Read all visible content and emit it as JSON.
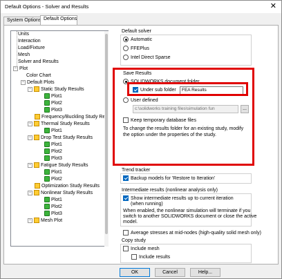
{
  "window": {
    "title": "Default Options - Solver and Results"
  },
  "tabs": [
    {
      "label": "System Options"
    },
    {
      "label": "Default Options"
    }
  ],
  "tree": {
    "items": [
      {
        "label": "Units"
      },
      {
        "label": "Interaction"
      },
      {
        "label": "Load/Fixture"
      },
      {
        "label": "Mesh"
      },
      {
        "label": "Solver and Results"
      },
      {
        "label": "Plot"
      },
      {
        "label": "Color Chart"
      },
      {
        "label": "Default Plots"
      },
      {
        "label": "Static Study Results"
      },
      {
        "label": "Plot1"
      },
      {
        "label": "Plot2"
      },
      {
        "label": "Plot3"
      },
      {
        "label": "Frequency/Buckling Study Res"
      },
      {
        "label": "Thermal Study Results"
      },
      {
        "label": "Plot1"
      },
      {
        "label": "Drop Test Study Results"
      },
      {
        "label": "Plot1"
      },
      {
        "label": "Plot2"
      },
      {
        "label": "Plot3"
      },
      {
        "label": "Fatigue Study Results"
      },
      {
        "label": "Plot1"
      },
      {
        "label": "Plot2"
      },
      {
        "label": "Optimization Study Results"
      },
      {
        "label": "Nonlinear Study Results"
      },
      {
        "label": "Plot1"
      },
      {
        "label": "Plot2"
      },
      {
        "label": "Plot3"
      },
      {
        "label": "Mesh Plot"
      }
    ]
  },
  "default_solver": {
    "heading": "Default solver",
    "options": [
      {
        "label": "Automatic",
        "selected": true
      },
      {
        "label": "FFEPlus",
        "selected": false
      },
      {
        "label": "Intel Direct Sparse",
        "selected": false
      }
    ]
  },
  "save_results": {
    "heading": "Save Results",
    "solidworks_folder": "SOLIDWORKS document folder",
    "under_sub_folder": "Under sub folder",
    "sub_folder_value": "FEA Results",
    "user_defined": "User defined",
    "user_path": "c:\\solidworks training files\\simulation fun",
    "browse_label": "...",
    "keep_temp": "Keep temporary database files",
    "note": "To change the results folder for an existing study, modify the option under the properties of the study."
  },
  "trend_tracker": {
    "heading": "Trend tracker",
    "backup": "Backup models for 'Restore to Iteration'"
  },
  "intermediate": {
    "heading": "Intermediate results (nonlinear analysis only)",
    "show_line1": "Show intermediate results up to current iteration",
    "show_line2": "(when running)",
    "note_line1": "When enabled, the nonlinear simulation will terminate if you",
    "note_line2": "switch to another SOLIDWORKS document or close the active",
    "note_line3": "model."
  },
  "average_stresses": "Average stresses at mid-nodes (high-quality solid mesh only)",
  "copy_study": {
    "heading": "Copy study",
    "include_mesh": "Include mesh",
    "include_results": "Include results"
  },
  "buttons": {
    "ok": "OK",
    "cancel": "Cancel",
    "help": "Help..."
  },
  "colors": {
    "highlight_red": "#e00000",
    "accent_blue": "#0067c0"
  }
}
